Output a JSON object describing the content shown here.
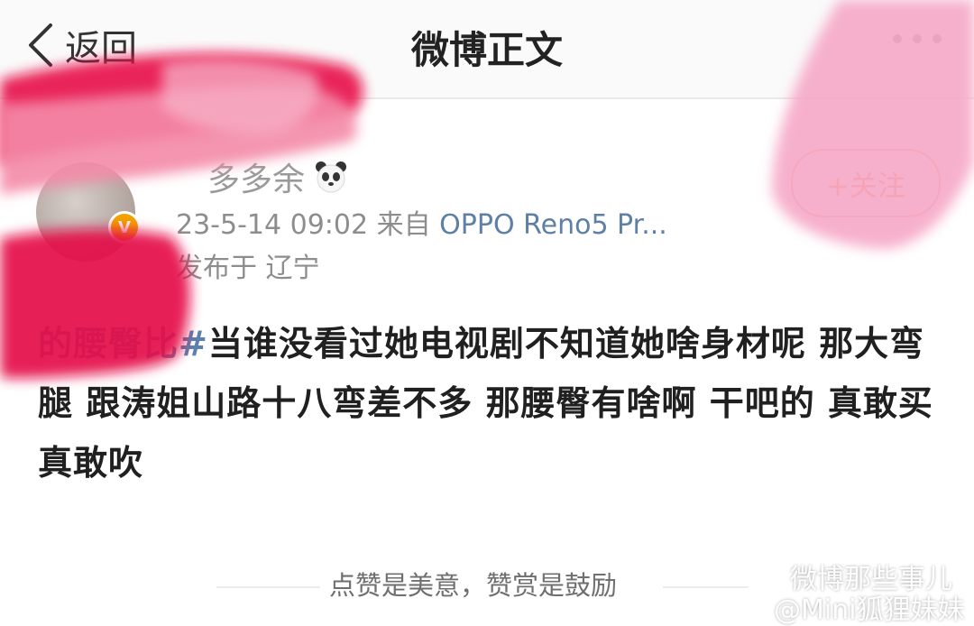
{
  "nav": {
    "back_label": "返回",
    "title": "微博正文"
  },
  "author": {
    "username": "多多余",
    "timestamp": "23-5-14 09:02",
    "source_prefix": "来自",
    "source_device": "OPPO Reno5 Pr...",
    "location": "发布于 辽宁",
    "follow_label": "+关注"
  },
  "post": {
    "hashtag_visible": "的腰臀比#",
    "body": "当谁没看过她电视剧不知道她啥身材呢  那大弯腿 跟涛姐山路十八弯差不多 那腰臀有啥啊 干吧的 真敢买真敢吹"
  },
  "footer": {
    "reward_text": "点赞是美意，赞赏是鼓励"
  },
  "watermark": {
    "line1": "微博那些事儿",
    "line2": "@Mini狐狸妹妹"
  },
  "colors": {
    "accent_orange": "#f07c32",
    "link_blue": "#5e7fa6",
    "mask_pink": "#f7a6c6",
    "mask_red": "#e8104a"
  }
}
